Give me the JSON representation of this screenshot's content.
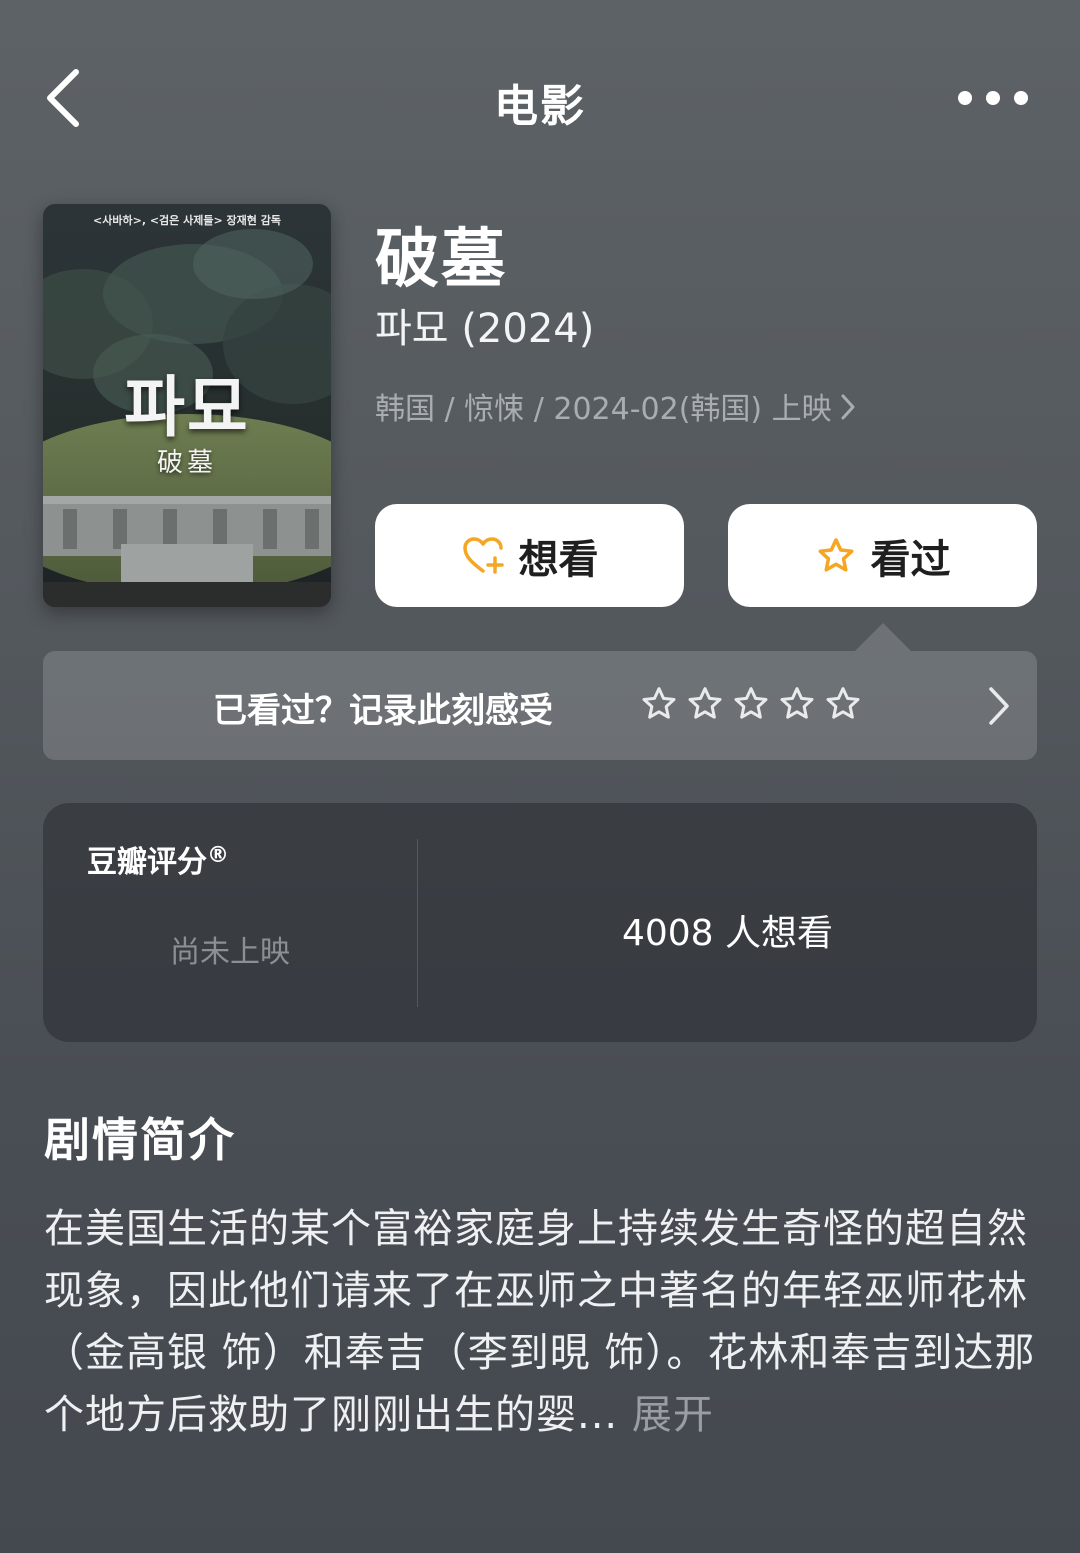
{
  "nav": {
    "title": "电影",
    "back_icon": "chevron-left-icon",
    "more_icon": "more-dots-icon"
  },
  "poster": {
    "top_text": "<사바하>, <검은 사제들> 장재현 감독",
    "title_ko": "파묘",
    "title_zh": "破墓"
  },
  "movie": {
    "title": "破墓",
    "original_title": "파묘 (2024)",
    "meta": "韩国 / 惊悚 / 2024-02(韩国) 上映"
  },
  "actions": {
    "want_label": "想看",
    "seen_label": "看过",
    "accent_color": "#f5a623"
  },
  "rating_prompt": {
    "text": "已看过？记录此刻感受",
    "star_count": 5
  },
  "score": {
    "label": "豆瓣评分",
    "label_mark": "®",
    "status": "尚未上映",
    "wish_count": "4008 人想看"
  },
  "synopsis": {
    "title": "剧情简介",
    "text": "在美国生活的某个富裕家庭身上持续发生奇怪的超自然现象，因此他们请来了在巫师之中著名的年轻巫师花林（金高银 饰）和奉吉（李到晛 饰）。花林和奉吉到达那个地方后救助了刚刚出生的婴...",
    "expand_label": "展开"
  }
}
